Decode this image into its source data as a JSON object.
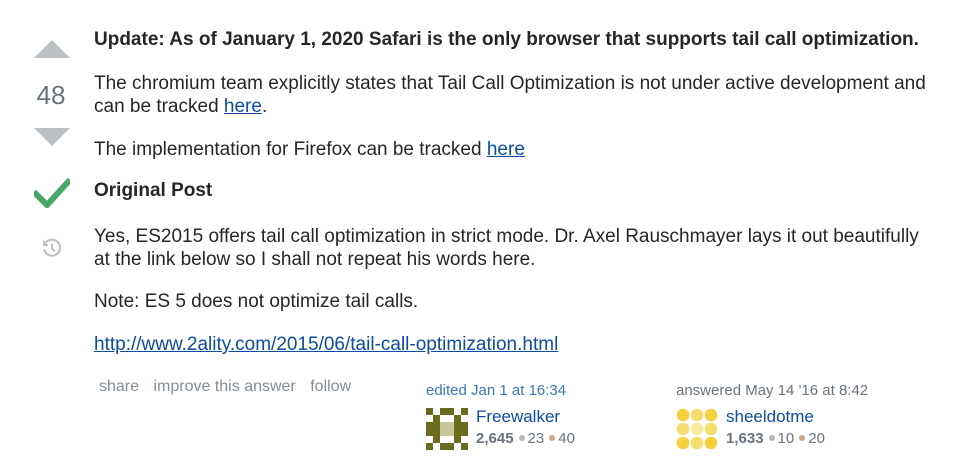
{
  "vote": {
    "count": "48"
  },
  "post": {
    "update": "Update: As of January 1, 2020 Safari is the only browser that supports tail call optimization.",
    "chromium_text": "The chromium team explicitly states that Tail Call Optimization is not under active development and can be tracked ",
    "chromium_link": "here",
    "chromium_after": ".",
    "firefox_text": "The implementation for Firefox can be tracked ",
    "firefox_link": "here",
    "original_heading": "Original Post",
    "yes_text": "Yes, ES2015 offers tail call optimization in strict mode. Dr. Axel Rauschmayer lays it out beautifully at the link below so I shall not repeat his words here.",
    "note_text": "Note: ES 5 does not optimize tail calls.",
    "link_url": "http://www.2ality.com/2015/06/tail-call-optimization.html"
  },
  "menu": {
    "share": "share",
    "improve": "improve this answer",
    "follow": "follow"
  },
  "editor": {
    "action": "edited Jan 1 at 16:34",
    "name": "Freewalker",
    "rep": "2,645",
    "silver": "23",
    "bronze": "40"
  },
  "author": {
    "action": "answered May 14 '16 at 8:42",
    "name": "sheeldotme",
    "rep": "1,633",
    "silver": "10",
    "bronze": "20"
  },
  "colors": {
    "link": "#0c4da2",
    "accepted": "#48a868",
    "vote_arrow": "#bbc0c4",
    "silver": "#b4b8bc",
    "bronze": "#d1a684"
  }
}
